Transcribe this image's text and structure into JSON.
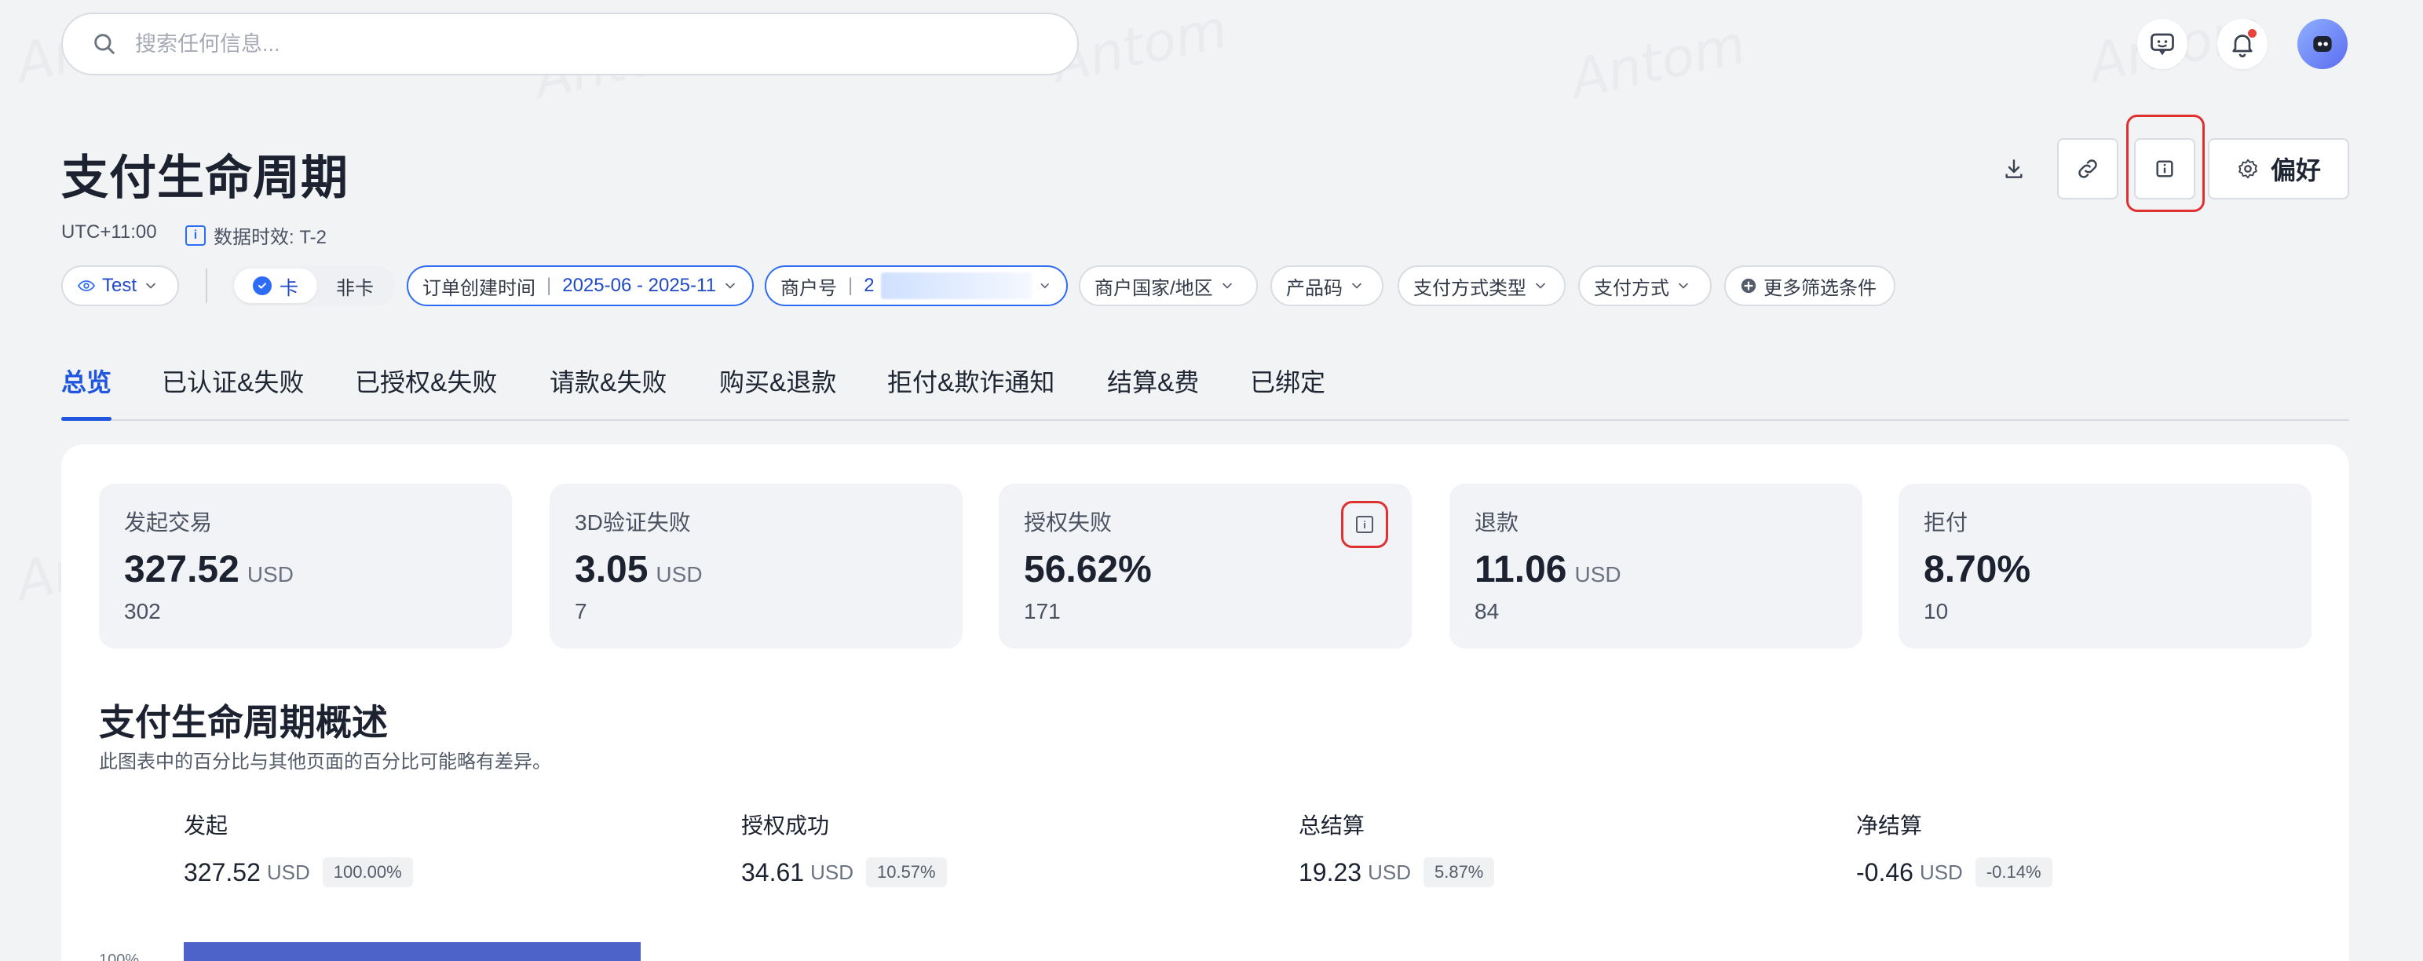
{
  "search": {
    "placeholder": "搜索任何信息..."
  },
  "page": {
    "title": "支付生命周期",
    "timezone": "UTC+11:00",
    "data_freshness": "数据时效: T-2",
    "preferences_label": "偏好"
  },
  "filters": {
    "env": "Test",
    "segment": [
      "卡",
      "非卡"
    ],
    "order_time_label": "订单创建时间",
    "order_time_value": "2025-06 - 2025-11",
    "merchant_label": "商户号",
    "merchant_value": "2",
    "country_label": "商户国家/地区",
    "product_label": "产品码",
    "method_type_label": "支付方式类型",
    "method_label": "支付方式",
    "more_label": "更多筛选条件"
  },
  "tabs": [
    "总览",
    "已认证&失败",
    "已授权&失败",
    "请款&失败",
    "购买&退款",
    "拒付&欺诈通知",
    "结算&费",
    "已绑定"
  ],
  "kpis": [
    {
      "label": "发起交易",
      "value": "327.52",
      "unit": "USD",
      "count": "302"
    },
    {
      "label": "3D验证失败",
      "value": "3.05",
      "unit": "USD",
      "count": "7"
    },
    {
      "label": "授权失败",
      "value": "56.62%",
      "unit": "",
      "count": "171"
    },
    {
      "label": "退款",
      "value": "11.06",
      "unit": "USD",
      "count": "84"
    },
    {
      "label": "拒付",
      "value": "8.70%",
      "unit": "",
      "count": "10"
    }
  ],
  "overview": {
    "title": "支付生命周期概述",
    "subtitle": "此图表中的百分比与其他页面的百分比可能略有差异。",
    "stages": [
      {
        "label": "发起",
        "value": "327.52",
        "unit": "USD",
        "pct": "100.00%"
      },
      {
        "label": "授权成功",
        "value": "34.61",
        "unit": "USD",
        "pct": "10.57%"
      },
      {
        "label": "总结算",
        "value": "19.23",
        "unit": "USD",
        "pct": "5.87%"
      },
      {
        "label": "净结算",
        "value": "-0.46",
        "unit": "USD",
        "pct": "-0.14%"
      }
    ],
    "axis_top": "100%"
  },
  "colors": {
    "accent": "#1f56e0",
    "bar": "#4e63c9",
    "highlight": "#e03131"
  },
  "watermark": "Antom"
}
